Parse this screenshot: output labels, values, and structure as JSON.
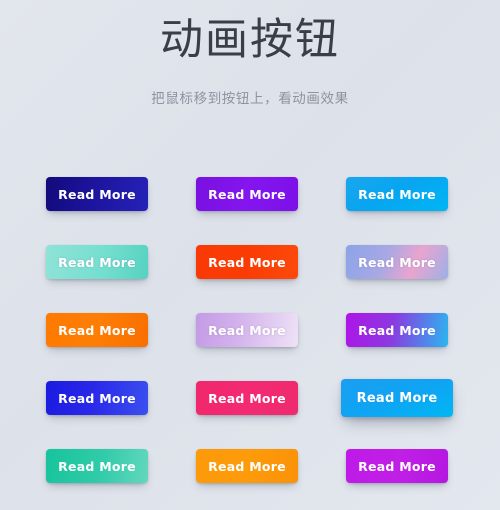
{
  "header": {
    "title": "动画按钮",
    "subtitle": "把鼠标移到按钮上，看动画效果",
    "title_color": "#3a3f47",
    "subtitle_color": "#8d949f"
  },
  "theme": {
    "background": "#dfe3ea",
    "button_text_color": "#ffffff"
  },
  "buttons": {
    "default_label": "Read More",
    "rows": [
      {
        "row_index": 1,
        "cells": [
          {
            "label": "Read More",
            "name": "button-navy",
            "style": "linear-gradient(100deg,#120a7a 0%,#1b1298 38%,#2522b8 100%)",
            "hovered": false
          },
          {
            "label": "Read More",
            "name": "button-violet",
            "style": "linear-gradient(100deg,#7a10e0 0%,#8415ef 50%,#7d10e8 100%)",
            "hovered": false
          },
          {
            "label": "Read More",
            "name": "button-sky-blue",
            "style": "linear-gradient(150deg,#1aa6ee 0%,#08a5f0 45%,#00b6f5 100%)",
            "hovered": false
          }
        ]
      },
      {
        "row_index": 2,
        "cells": [
          {
            "label": "Read More",
            "name": "button-mint",
            "style": "linear-gradient(100deg,#8fe3d7 0%,#75dfcf 55%,#56d2c0 100%)",
            "hovered": false
          },
          {
            "label": "Read More",
            "name": "button-orange-red",
            "style": "linear-gradient(100deg,#f93a06 0%,#fa3c04 50%,#fc4a0c 100%)",
            "hovered": false
          },
          {
            "label": "Read More",
            "name": "button-blue-pink-gradient",
            "style": "linear-gradient(115deg,#8ba4e8 0%,#a7a8e4 38%,#e9a4cf 66%,#9db0e6 100%)",
            "hovered": false
          }
        ]
      },
      {
        "row_index": 3,
        "cells": [
          {
            "label": "Read More",
            "name": "button-orange",
            "style": "linear-gradient(100deg,#ff7a00 0%,#fd7e05 50%,#f96f00 100%)",
            "hovered": false
          },
          {
            "label": "Read More",
            "name": "button-lilac-fade",
            "style": "linear-gradient(100deg,#c49ae6 0%,#d3b1ec 40%,#eee2f6 100%)",
            "hovered": false
          },
          {
            "label": "Read More",
            "name": "button-purple-cyan-gradient",
            "style": "linear-gradient(100deg,#ae14e8 0%,#8b3ae0 45%,#2bb6f0 100%)",
            "hovered": false
          }
        ]
      },
      {
        "row_index": 4,
        "cells": [
          {
            "label": "Read More",
            "name": "button-royal-blue",
            "style": "linear-gradient(100deg,#1b1ae0 0%,#2a28e8 45%,#3a50f0 100%)",
            "hovered": false
          },
          {
            "label": "Read More",
            "name": "button-pink",
            "style": "linear-gradient(100deg,#f0276b 0%,#f32a72 50%,#ef2a6e 100%)",
            "hovered": false
          },
          {
            "label": "Read More",
            "name": "button-bright-blue-hovered",
            "style": "linear-gradient(160deg,#1b9ef2 0%,#0fa4f3 50%,#00b7f4 100%)",
            "hovered": true
          }
        ]
      },
      {
        "row_index": 5,
        "cells": [
          {
            "label": "Read More",
            "name": "button-teal",
            "style": "linear-gradient(100deg,#16c49c 0%,#32cbaa 55%,#62d8bd 100%)",
            "hovered": false
          },
          {
            "label": "Read More",
            "name": "button-amber",
            "style": "linear-gradient(100deg,#fd9a0a 0%,#fd9b0a 50%,#fb9208 100%)",
            "hovered": false
          },
          {
            "label": "Read More",
            "name": "button-magenta",
            "style": "linear-gradient(100deg,#bf1ae8 0%,#c01fe6 50%,#b418e0 100%)",
            "hovered": false
          }
        ]
      }
    ]
  }
}
